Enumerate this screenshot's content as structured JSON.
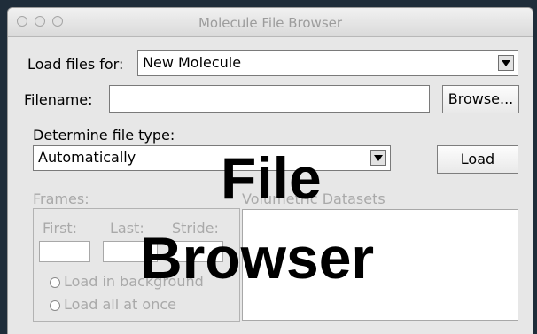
{
  "window": {
    "title": "Molecule File Browser",
    "traffic_lights": [
      "close",
      "minimize",
      "zoom"
    ]
  },
  "load_for": {
    "label": "Load files for:",
    "selected": "New Molecule"
  },
  "filename": {
    "label": "Filename:",
    "value": "",
    "browse_label": "Browse..."
  },
  "file_type": {
    "label": "Determine file type:",
    "selected": "Automatically",
    "load_label": "Load"
  },
  "frames": {
    "group_label": "Frames:",
    "first_label": "First:",
    "last_label": "Last:",
    "stride_label": "Stride:",
    "first_value": "",
    "last_value": "",
    "stride_value": "",
    "options": [
      "Load in background",
      "Load all at once"
    ]
  },
  "volumetric": {
    "label": "Volumetric Datasets"
  },
  "overlay": {
    "line1": "File",
    "line2": "Browser"
  }
}
